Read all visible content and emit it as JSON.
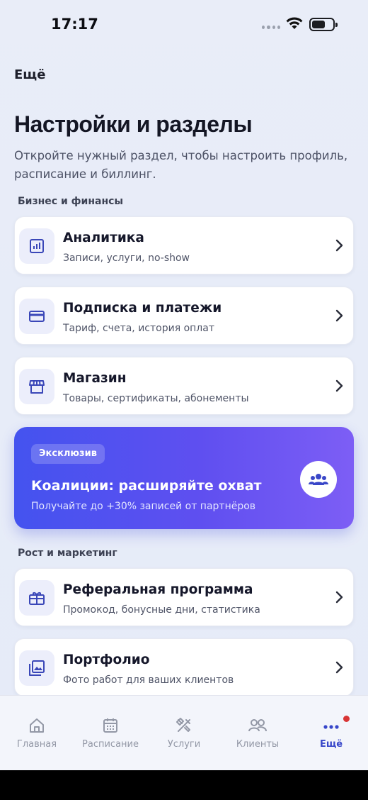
{
  "status_bar": {
    "time": "17:17"
  },
  "header": {
    "nav_title": "Ещё",
    "title": "Настройки и разделы",
    "subtitle": "Откройте нужный раздел, чтобы настроить профиль, расписание и биллинг."
  },
  "sections": [
    {
      "label": "Бизнес и финансы",
      "items": [
        {
          "title": "Аналитика",
          "subtitle": "Записи, услуги, no-show",
          "icon": "chart-icon"
        },
        {
          "title": "Подписка и платежи",
          "subtitle": "Тариф, счета, история оплат",
          "icon": "credit-card-icon"
        },
        {
          "title": "Магазин",
          "subtitle": "Товары, сертификаты, абонементы",
          "icon": "store-icon"
        }
      ]
    },
    {
      "label": "Рост и маркетинг",
      "items": [
        {
          "title": "Реферальная программа",
          "subtitle": "Промокод, бонусные дни, статистика",
          "icon": "gift-icon"
        },
        {
          "title": "Портфолио",
          "subtitle": "Фото работ для ваших клиентов",
          "icon": "photo-icon"
        }
      ]
    }
  ],
  "promo": {
    "badge": "Эксклюзив",
    "title": "Коалиции: расширяйте охват",
    "subtitle": "Получайте до +30% записей от партнёров",
    "icon": "group-icon"
  },
  "tabbar": {
    "tabs": [
      {
        "label": "Главная",
        "icon": "home-icon",
        "active": false
      },
      {
        "label": "Расписание",
        "icon": "calendar-icon",
        "active": false
      },
      {
        "label": "Услуги",
        "icon": "tools-icon",
        "active": false
      },
      {
        "label": "Клиенты",
        "icon": "clients-icon",
        "active": false
      },
      {
        "label": "Ещё",
        "icon": "more-icon",
        "active": true
      }
    ]
  },
  "colors": {
    "accent": "#3746c9",
    "promo_gradient_start": "#4453ef",
    "promo_gradient_end": "#7d5ef5",
    "notification_dot": "#d83535"
  }
}
